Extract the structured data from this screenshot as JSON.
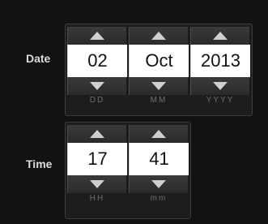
{
  "date": {
    "label": "Date",
    "fields": [
      {
        "value": "02",
        "unit": "DD"
      },
      {
        "value": "Oct",
        "unit": "MM"
      },
      {
        "value": "2013",
        "unit": "YYYY"
      }
    ]
  },
  "time": {
    "label": "Time",
    "fields": [
      {
        "value": "17",
        "unit": "HH"
      },
      {
        "value": "41",
        "unit": "mm"
      }
    ]
  },
  "icons": {
    "up": "triangle-up-icon",
    "down": "triangle-down-icon"
  },
  "colors": {
    "background": "#121212",
    "button": "#333333",
    "arrow": "#cfcfcf",
    "value_bg": "#ffffff",
    "label": "#dcdcdc",
    "unit": "#6e6e6e"
  }
}
